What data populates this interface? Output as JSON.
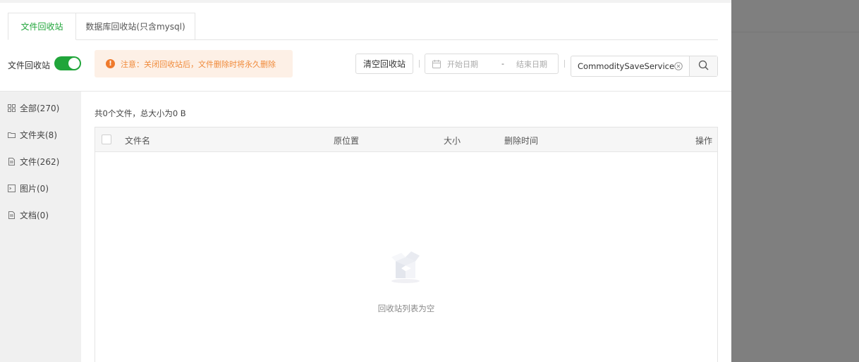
{
  "tabs": [
    {
      "label": "文件回收站",
      "active": true
    },
    {
      "label": "数据库回收站(只含mysql)",
      "active": false
    }
  ],
  "toggle": {
    "label": "文件回收站",
    "on": true
  },
  "notice": {
    "icon": "exclamation-icon",
    "text": "注意：关闭回收站后，文件删除时将永久删除"
  },
  "toolbar": {
    "clear_button": "清空回收站",
    "date_start_placeholder": "开始日期",
    "date_separator": "-",
    "date_end_placeholder": "结束日期",
    "search_value": "CommoditySaveService"
  },
  "sidebar": {
    "items": [
      {
        "label": "全部(270)",
        "icon": "grid-icon"
      },
      {
        "label": "文件夹(8)",
        "icon": "folder-icon"
      },
      {
        "label": "文件(262)",
        "icon": "file-icon"
      },
      {
        "label": "图片(0)",
        "icon": "image-icon"
      },
      {
        "label": "文档(0)",
        "icon": "document-icon"
      }
    ]
  },
  "summary": "共0个文件，总大小为0 B",
  "table": {
    "columns": [
      "文件名",
      "原位置",
      "大小",
      "删除时间",
      "操作"
    ],
    "empty_text": "回收站列表为空"
  },
  "colors": {
    "accent": "#20a53a",
    "notice_bg": "#fdf0e6",
    "notice_text": "#f08a3a",
    "overlay": "#7f7f7f"
  }
}
